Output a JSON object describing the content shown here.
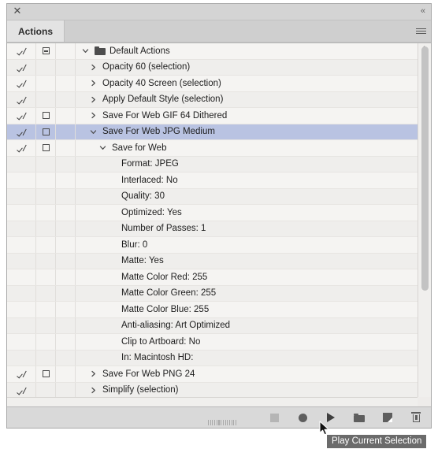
{
  "window": {
    "close_icon": "close-icon",
    "collapse_icon": "collapse-double-chevron-icon",
    "collapse_glyph": "«",
    "close_glyph": "✕"
  },
  "tabs": [
    {
      "label": "Actions",
      "active": true
    }
  ],
  "panel_menu": {
    "icon": "panel-menu-hamburger-icon"
  },
  "list": {
    "rows": [
      {
        "label": "Default Actions",
        "indent": 0,
        "check": true,
        "dialog": "minus",
        "twisty": "down",
        "folder": true,
        "selected": false,
        "alt": false,
        "kind": "set"
      },
      {
        "label": "Opacity 60 (selection)",
        "indent": 1,
        "check": true,
        "dialog": "none",
        "twisty": "right",
        "folder": false,
        "selected": false,
        "alt": true,
        "kind": "action"
      },
      {
        "label": "Opacity 40 Screen (selection)",
        "indent": 1,
        "check": true,
        "dialog": "none",
        "twisty": "right",
        "folder": false,
        "selected": false,
        "alt": false,
        "kind": "action"
      },
      {
        "label": "Apply Default Style (selection)",
        "indent": 1,
        "check": true,
        "dialog": "none",
        "twisty": "right",
        "folder": false,
        "selected": false,
        "alt": true,
        "kind": "action"
      },
      {
        "label": "Save For Web GIF 64 Dithered",
        "indent": 1,
        "check": true,
        "dialog": "box",
        "twisty": "right",
        "folder": false,
        "selected": false,
        "alt": false,
        "kind": "action"
      },
      {
        "label": "Save For Web JPG Medium",
        "indent": 1,
        "check": true,
        "dialog": "box",
        "twisty": "down",
        "folder": false,
        "selected": true,
        "alt": true,
        "kind": "action"
      },
      {
        "label": "Save for Web",
        "indent": 2,
        "check": true,
        "dialog": "box",
        "twisty": "down",
        "folder": false,
        "selected": false,
        "alt": false,
        "kind": "command"
      },
      {
        "label": "Format: JPEG",
        "indent": 3,
        "check": false,
        "dialog": "none",
        "twisty": "none",
        "folder": false,
        "selected": false,
        "alt": true,
        "kind": "param"
      },
      {
        "label": "Interlaced: No",
        "indent": 3,
        "check": false,
        "dialog": "none",
        "twisty": "none",
        "folder": false,
        "selected": false,
        "alt": false,
        "kind": "param"
      },
      {
        "label": "Quality: 30",
        "indent": 3,
        "check": false,
        "dialog": "none",
        "twisty": "none",
        "folder": false,
        "selected": false,
        "alt": true,
        "kind": "param"
      },
      {
        "label": "Optimized: Yes",
        "indent": 3,
        "check": false,
        "dialog": "none",
        "twisty": "none",
        "folder": false,
        "selected": false,
        "alt": false,
        "kind": "param"
      },
      {
        "label": "Number of Passes: 1",
        "indent": 3,
        "check": false,
        "dialog": "none",
        "twisty": "none",
        "folder": false,
        "selected": false,
        "alt": true,
        "kind": "param"
      },
      {
        "label": "Blur: 0",
        "indent": 3,
        "check": false,
        "dialog": "none",
        "twisty": "none",
        "folder": false,
        "selected": false,
        "alt": false,
        "kind": "param"
      },
      {
        "label": "Matte: Yes",
        "indent": 3,
        "check": false,
        "dialog": "none",
        "twisty": "none",
        "folder": false,
        "selected": false,
        "alt": true,
        "kind": "param"
      },
      {
        "label": "Matte Color Red: 255",
        "indent": 3,
        "check": false,
        "dialog": "none",
        "twisty": "none",
        "folder": false,
        "selected": false,
        "alt": false,
        "kind": "param"
      },
      {
        "label": "Matte Color Green: 255",
        "indent": 3,
        "check": false,
        "dialog": "none",
        "twisty": "none",
        "folder": false,
        "selected": false,
        "alt": true,
        "kind": "param"
      },
      {
        "label": "Matte Color Blue: 255",
        "indent": 3,
        "check": false,
        "dialog": "none",
        "twisty": "none",
        "folder": false,
        "selected": false,
        "alt": false,
        "kind": "param"
      },
      {
        "label": "Anti-aliasing: Art Optimized",
        "indent": 3,
        "check": false,
        "dialog": "none",
        "twisty": "none",
        "folder": false,
        "selected": false,
        "alt": true,
        "kind": "param"
      },
      {
        "label": "Clip to Artboard: No",
        "indent": 3,
        "check": false,
        "dialog": "none",
        "twisty": "none",
        "folder": false,
        "selected": false,
        "alt": false,
        "kind": "param"
      },
      {
        "label": "In: Macintosh HD:",
        "indent": 3,
        "check": false,
        "dialog": "none",
        "twisty": "none",
        "folder": false,
        "selected": false,
        "alt": true,
        "kind": "param"
      },
      {
        "label": "Save For Web PNG 24",
        "indent": 1,
        "check": true,
        "dialog": "box",
        "twisty": "right",
        "folder": false,
        "selected": false,
        "alt": false,
        "kind": "action"
      },
      {
        "label": "Simplify (selection)",
        "indent": 1,
        "check": true,
        "dialog": "none",
        "twisty": "right",
        "folder": false,
        "selected": false,
        "alt": true,
        "kind": "action"
      }
    ]
  },
  "toolbar": {
    "buttons": [
      {
        "name": "stop-playing-button",
        "icon": "stop-square-icon",
        "label": "Stop playing/recording",
        "enabled": false
      },
      {
        "name": "begin-recording-button",
        "icon": "record-circle-icon",
        "label": "Begin recording",
        "enabled": true
      },
      {
        "name": "play-current-selection-button",
        "icon": "play-triangle-icon",
        "label": "Play Current Selection",
        "enabled": true
      },
      {
        "name": "create-new-set-button",
        "icon": "folder-icon",
        "label": "Create New Set",
        "enabled": true
      },
      {
        "name": "create-new-action-button",
        "icon": "new-page-icon",
        "label": "Create New Action",
        "enabled": true
      },
      {
        "name": "delete-selection-button",
        "icon": "trash-icon",
        "label": "Delete Selection",
        "enabled": true
      }
    ]
  },
  "tooltip": {
    "text": "Play Current Selection",
    "visible": true
  },
  "cursor": {
    "icon": "mouse-pointer-arrow"
  },
  "scrollbars": {
    "vertical": {
      "name": "vertical-scrollbar",
      "arrow_glyph": "⌃"
    },
    "horizontal": {
      "name": "horizontal-scrollbar"
    }
  },
  "resize_grip": {
    "name": "resize-grip"
  },
  "colors": {
    "selection": "#b9c3e2",
    "panel_bg": "#d6d6d6",
    "list_bg": "#f5f4f2",
    "row_alt": "#efeeec",
    "tooltip_bg": "#6b6b6b"
  }
}
